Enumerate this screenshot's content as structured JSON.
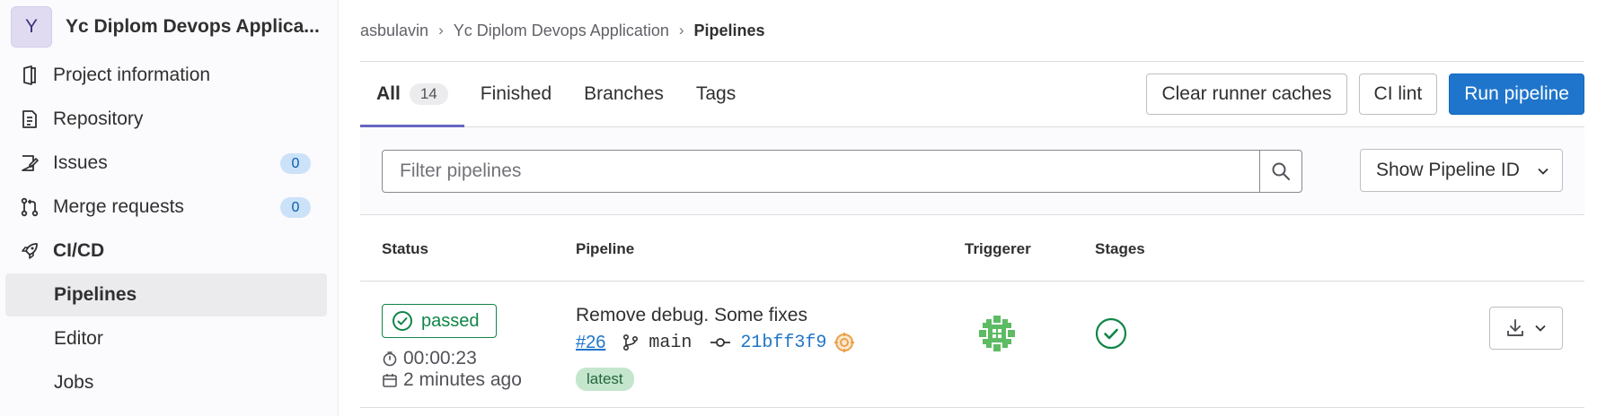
{
  "sidebar": {
    "project_avatar_letter": "Y",
    "project_name": "Yc Diplom Devops Applica...",
    "items": [
      {
        "label": "Project information",
        "icon": "project-information-icon"
      },
      {
        "label": "Repository",
        "icon": "repository-icon"
      },
      {
        "label": "Issues",
        "icon": "issues-icon",
        "count": "0"
      },
      {
        "label": "Merge requests",
        "icon": "merge-requests-icon",
        "count": "0"
      },
      {
        "label": "CI/CD",
        "icon": "rocket-icon"
      }
    ],
    "sub_items": [
      {
        "label": "Pipelines",
        "active": true
      },
      {
        "label": "Editor"
      },
      {
        "label": "Jobs"
      }
    ]
  },
  "breadcrumb": {
    "items": [
      "asbulavin",
      "Yc Diplom Devops Application"
    ],
    "current": "Pipelines"
  },
  "tabs": [
    {
      "label": "All",
      "count": "14",
      "active": true
    },
    {
      "label": "Finished"
    },
    {
      "label": "Branches"
    },
    {
      "label": "Tags"
    }
  ],
  "actions": {
    "clear_caches": "Clear runner caches",
    "ci_lint": "CI lint",
    "run_pipeline": "Run pipeline"
  },
  "filter": {
    "placeholder": "Filter pipelines",
    "show_pipeline_id": "Show Pipeline ID"
  },
  "table": {
    "headers": {
      "status": "Status",
      "pipeline": "Pipeline",
      "triggerer": "Triggerer",
      "stages": "Stages"
    },
    "rows": [
      {
        "status": "passed",
        "duration": "00:00:23",
        "finished": "2 minutes ago",
        "title": "Remove debug. Some fixes",
        "id": "#26",
        "branch": "main",
        "sha": "21bff3f9",
        "badge": "latest"
      }
    ]
  },
  "colors": {
    "primary": "#1f75cb",
    "success": "#108548",
    "tab_underline": "#6666c4",
    "count_badge_bg": "#cbe2f9"
  }
}
